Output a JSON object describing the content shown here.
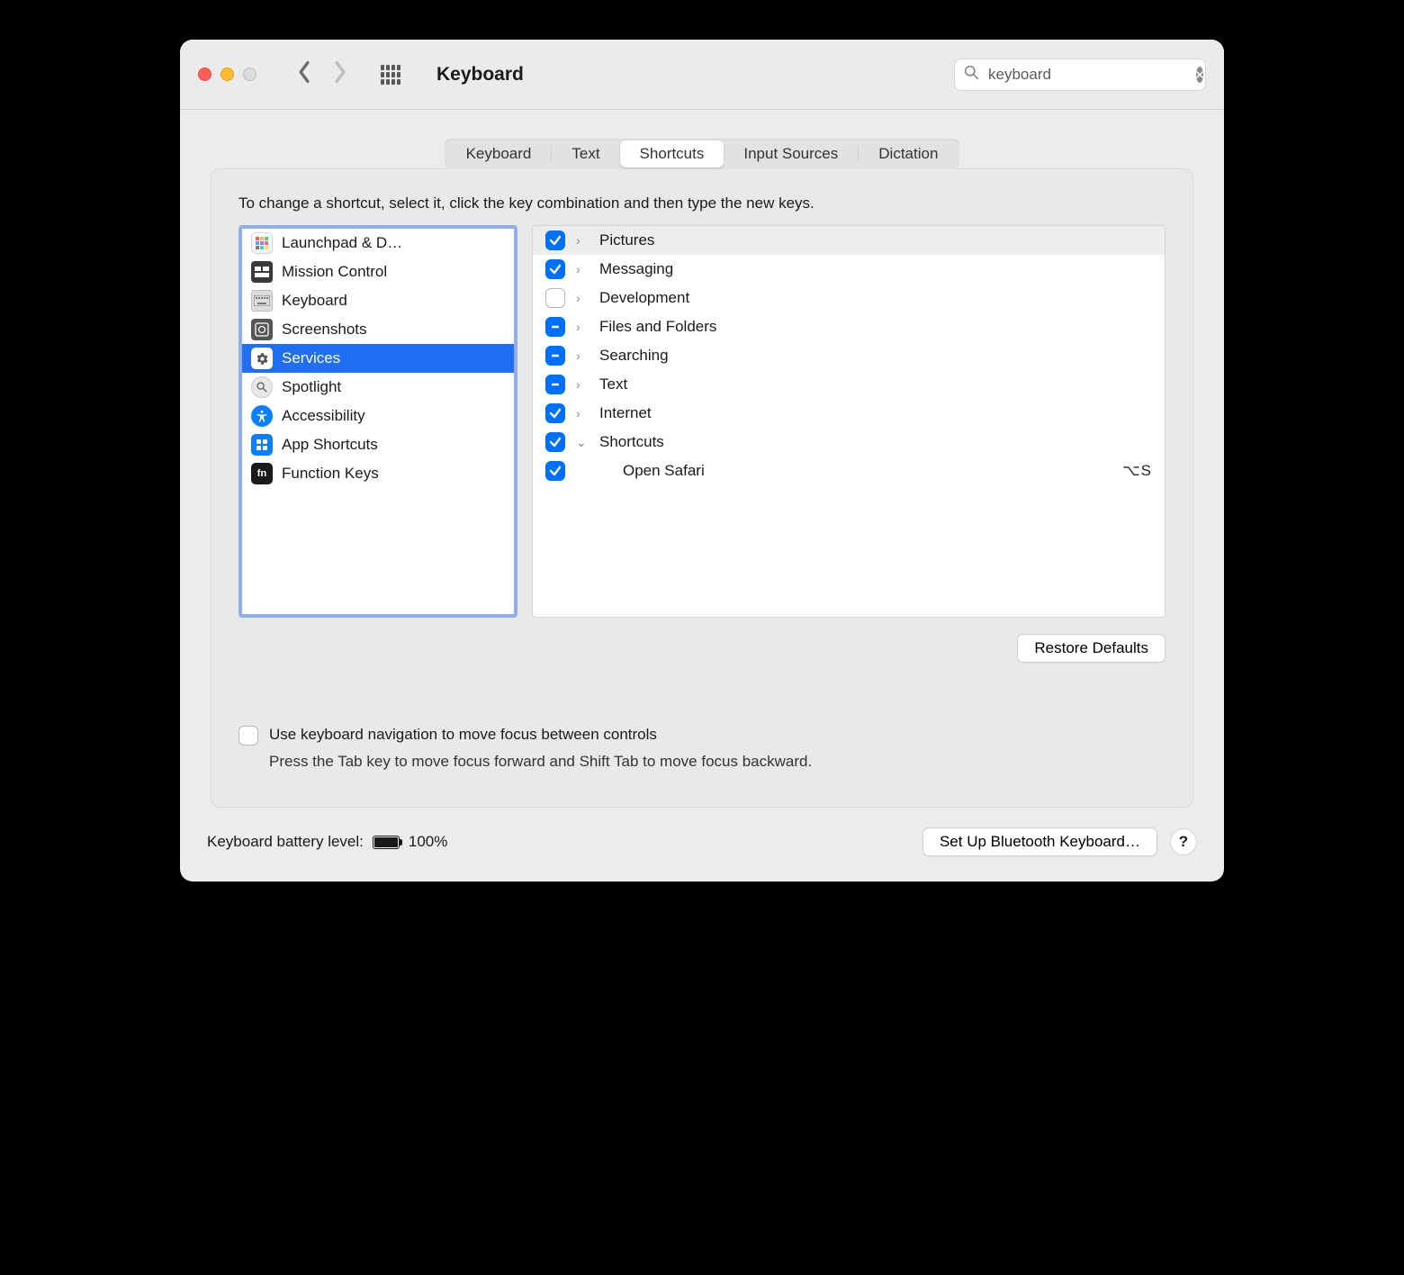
{
  "window": {
    "title": "Keyboard"
  },
  "search": {
    "value": "keyboard"
  },
  "tabs": [
    {
      "label": "Keyboard"
    },
    {
      "label": "Text"
    },
    {
      "label": "Shortcuts",
      "active": true
    },
    {
      "label": "Input Sources"
    },
    {
      "label": "Dictation"
    }
  ],
  "hint": "To change a shortcut, select it, click the key combination and then type the new keys.",
  "categories": [
    {
      "label": "Launchpad & D…",
      "icon": "launchpad"
    },
    {
      "label": "Mission Control",
      "icon": "mission"
    },
    {
      "label": "Keyboard",
      "icon": "keyboard"
    },
    {
      "label": "Screenshots",
      "icon": "screenshots"
    },
    {
      "label": "Services",
      "icon": "services",
      "selected": true
    },
    {
      "label": "Spotlight",
      "icon": "spotlight"
    },
    {
      "label": "Accessibility",
      "icon": "accessibility"
    },
    {
      "label": "App Shortcuts",
      "icon": "apps"
    },
    {
      "label": "Function Keys",
      "icon": "fn"
    }
  ],
  "shortcuts": [
    {
      "label": "Pictures",
      "state": "checked",
      "expanded": false,
      "highlighted": true
    },
    {
      "label": "Messaging",
      "state": "checked",
      "expanded": false
    },
    {
      "label": "Development",
      "state": "unchecked",
      "expanded": false
    },
    {
      "label": "Files and Folders",
      "state": "mixed",
      "expanded": false
    },
    {
      "label": "Searching",
      "state": "mixed",
      "expanded": false
    },
    {
      "label": "Text",
      "state": "mixed",
      "expanded": false
    },
    {
      "label": "Internet",
      "state": "checked",
      "expanded": false
    },
    {
      "label": "Shortcuts",
      "state": "checked",
      "expanded": true,
      "children": [
        {
          "label": "Open Safari",
          "state": "checked",
          "keys": "⌥S"
        }
      ]
    }
  ],
  "buttons": {
    "restore": "Restore Defaults",
    "bluetooth": "Set Up Bluetooth Keyboard…"
  },
  "navopt": {
    "line1": "Use keyboard navigation to move focus between controls",
    "line2": "Press the Tab key to move focus forward and Shift Tab to move focus backward."
  },
  "battery": {
    "label": "Keyboard battery level:",
    "percent": "100%"
  },
  "help": "?"
}
